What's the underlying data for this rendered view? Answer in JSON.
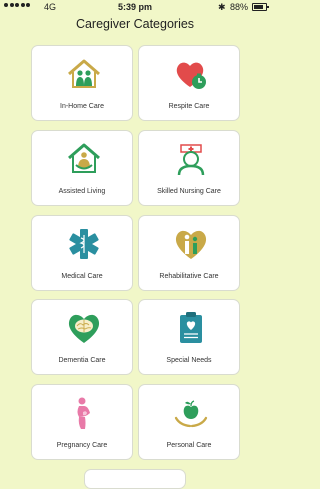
{
  "status_bar": {
    "carrier": "4G",
    "time": "5:39 pm",
    "bluetooth": "✱",
    "battery": "88%"
  },
  "header": {
    "title": "Caregiver Categories"
  },
  "categories": [
    {
      "label": "In-Home Care",
      "icon": "home-family-icon"
    },
    {
      "label": "Respite Care",
      "icon": "heart-clock-icon"
    },
    {
      "label": "Assisted Living",
      "icon": "house-people-icon"
    },
    {
      "label": "Skilled Nursing Care",
      "icon": "nurse-icon"
    },
    {
      "label": "Medical Care",
      "icon": "medical-star-icon"
    },
    {
      "label": "Rehabilitative Care",
      "icon": "heart-rehab-icon"
    },
    {
      "label": "Dementia Care",
      "icon": "brain-heart-icon"
    },
    {
      "label": "Special Needs",
      "icon": "clipboard-heart-icon"
    },
    {
      "label": "Pregnancy Care",
      "icon": "pregnancy-icon"
    },
    {
      "label": "Personal Care",
      "icon": "apple-hands-icon"
    }
  ],
  "colors": {
    "background": "#f1f7c8",
    "green": "#2e9e5b",
    "gold": "#c9a948",
    "red": "#e24b4b",
    "teal": "#2a8fa0",
    "pink": "#e87aa8"
  }
}
